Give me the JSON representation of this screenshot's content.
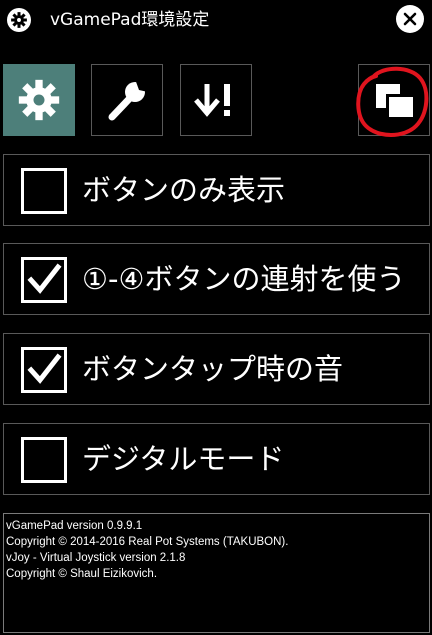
{
  "titlebar": {
    "app_icon": "gear-icon",
    "title": "vGamePad環境設定",
    "close_icon": "close-icon"
  },
  "toolbar": {
    "buttons": [
      {
        "icon": "gear-icon",
        "selected": true
      },
      {
        "icon": "wrench-icon",
        "selected": false
      },
      {
        "icon": "download-alert-icon",
        "selected": false
      },
      {
        "icon": "window-layout-icon",
        "selected": false
      }
    ]
  },
  "options": [
    {
      "label": "ボタンのみ表示",
      "checked": false
    },
    {
      "label": "①-④ボタンの連射を使う",
      "checked": true
    },
    {
      "label": "ボタンタップ時の音",
      "checked": true
    },
    {
      "label": "デジタルモード",
      "checked": false
    }
  ],
  "info": {
    "lines": [
      "vGamePad version 0.9.9.1",
      "Copyright © 2014-2016 Real Pot Systems (TAKUBON).",
      "vJoy - Virtual Joystick version 2.1.8",
      "Copyright © Shaul Eizikovich."
    ]
  },
  "colors": {
    "background": "#000000",
    "selected_tab": "#4d7f7a",
    "border": "#595959",
    "annotation": "#e0141e"
  }
}
